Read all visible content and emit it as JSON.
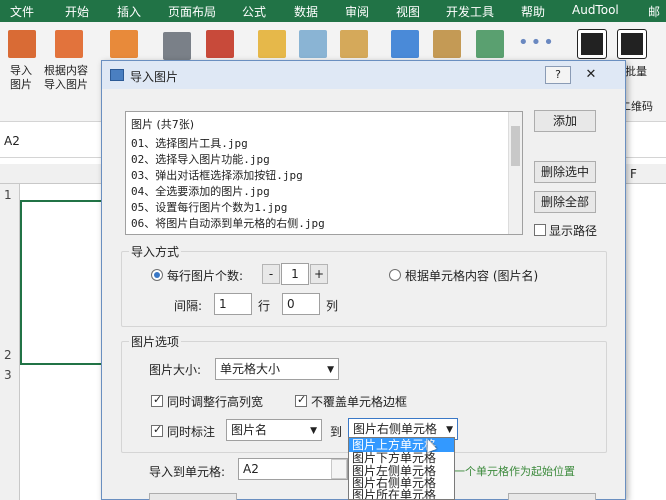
{
  "excel": {
    "tabs": [
      "文件",
      "开始",
      "插入",
      "页面布局",
      "公式",
      "数据",
      "审阅",
      "视图",
      "开发工具",
      "帮助",
      "AudTool",
      "邮"
    ],
    "ribbon": {
      "import_label1": "导入",
      "import_label2": "图片",
      "import_by_content_label1": "根据内容",
      "import_by_content_label2": "导入图片",
      "batch_label": "批量",
      "qr_label": "二维码"
    },
    "name_box": "A2",
    "col_F": "F",
    "rows": [
      "1",
      "2",
      "3"
    ]
  },
  "dialog": {
    "title": "导入图片",
    "help": "?",
    "list": {
      "header": "图片 (共7张)",
      "items": [
        "01、选择图片工具.jpg",
        "02、选择导入图片功能.jpg",
        "03、弹出对话框选择添加按钮.jpg",
        "04、全选要添加的图片.jpg",
        "05、设置每行图片个数为1.jpg",
        "06、将图片自动添到单元格的右侧.jpg"
      ]
    },
    "buttons": {
      "add": "添加",
      "delete_selected": "删除选中",
      "delete_all": "删除全部"
    },
    "show_path": "显示路径",
    "import_mode": {
      "title": "导入方式",
      "per_row_label": "每行图片个数:",
      "per_row_value": "1",
      "minus": "-",
      "plus": "+",
      "by_cell_label": "根据单元格内容 (图片名)",
      "spacing_label": "间隔:",
      "row_gap": "1",
      "row_unit": "行",
      "col_gap": "0",
      "col_unit": "列"
    },
    "image_options": {
      "title": "图片选项",
      "size_label": "图片大小:",
      "size_value": "单元格大小",
      "adjust_row_col": "同时调整行高列宽",
      "no_cover_border": "不覆盖单元格边框",
      "annotate": "同时标注",
      "annotate_value": "图片名",
      "to": "到",
      "position_value": "图片右侧单元格",
      "position_options": [
        "图片上方单元格",
        "图片下方单元格",
        "图片左侧单元格",
        "图片右侧单元格",
        "图片所在单元格"
      ]
    },
    "target": {
      "label": "导入到单元格:",
      "value": "A2",
      "hint": "一个单元格作为起始位置"
    }
  }
}
